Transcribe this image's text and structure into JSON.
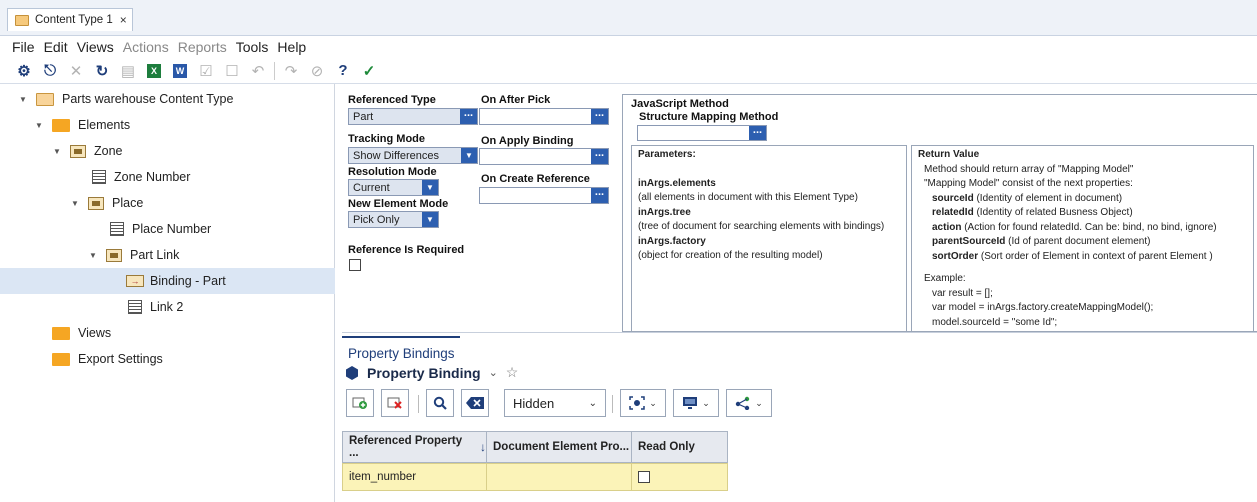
{
  "tab": {
    "title": "Content Type 1",
    "close": "×"
  },
  "menu": [
    "File",
    "Edit",
    "Views",
    "Actions",
    "Reports",
    "Tools",
    "Help"
  ],
  "tree": {
    "root": "Parts warehouse Content Type",
    "elements": "Elements",
    "zone": "Zone",
    "zone_number": "Zone Number",
    "place": "Place",
    "place_number": "Place Number",
    "part_link": "Part Link",
    "binding_part": "Binding - Part",
    "link2": "Link 2",
    "views": "Views",
    "export_settings": "Export Settings"
  },
  "form": {
    "referenced_type_label": "Referenced Type",
    "referenced_type_value": "Part",
    "tracking_mode_label": "Tracking Mode",
    "tracking_mode_value": "Show Differences",
    "resolution_mode_label": "Resolution Mode",
    "resolution_mode_value": "Current",
    "new_element_mode_label": "New Element Mode",
    "new_element_mode_value": "Pick Only",
    "reference_required_label": "Reference Is Required",
    "on_after_pick_label": "On After Pick",
    "on_apply_binding_label": "On Apply Binding",
    "on_create_reference_label": "On Create Reference",
    "dots": "..."
  },
  "js": {
    "title": "JavaScript Method",
    "smm_label": "Structure Mapping Method",
    "params_title": "Parameters:",
    "p1_name": "inArgs.elements",
    "p1_desc": "(all elements in document with this Element Type)",
    "p2_name": "inArgs.tree",
    "p2_desc": "(tree of document for searching elements with bindings)",
    "p3_name": "inArgs.factory",
    "p3_desc": "(object for creation of the resulting model)",
    "ret_title": "Return Value",
    "ret_l1": "Method should return array of \"Mapping Model\"",
    "ret_l2": "\"Mapping Model\" consist of the next properties:",
    "f1_name": "sourceId",
    "f1_desc": " (Identity of element in document)",
    "f2_name": "relatedId",
    "f2_desc": " (Identity of related Busness Object)",
    "f3_name": "action",
    "f3_desc": " (Action for found relatedId. Can be: bind, no bind, ignore)",
    "f4_name": "parentSourceId",
    "f4_desc": " (Id of parent document element)",
    "f5_name": "sortOrder",
    "f5_desc": " (Sort order of Element in context of parent Element )",
    "example_label": "Example:",
    "ex1": "var result = [];",
    "ex2": "var model = inArgs.factory.createMappingModel();",
    "ex3": "model.sourceId = \"some Id\";"
  },
  "bottom": {
    "tab_label": "Property Bindings",
    "title": "Property Binding",
    "filter_value": "Hidden"
  },
  "grid": {
    "headers": [
      "Referenced Property ...",
      "Document Element Pro...",
      "Read Only"
    ],
    "row": {
      "referenced_property": "item_number",
      "document_element": ""
    }
  },
  "colors": {
    "accent": "#2d5fb0",
    "navy": "#1f3e7a",
    "selection": "#dbe6f4",
    "row_yellow": "#fbf3b8"
  }
}
